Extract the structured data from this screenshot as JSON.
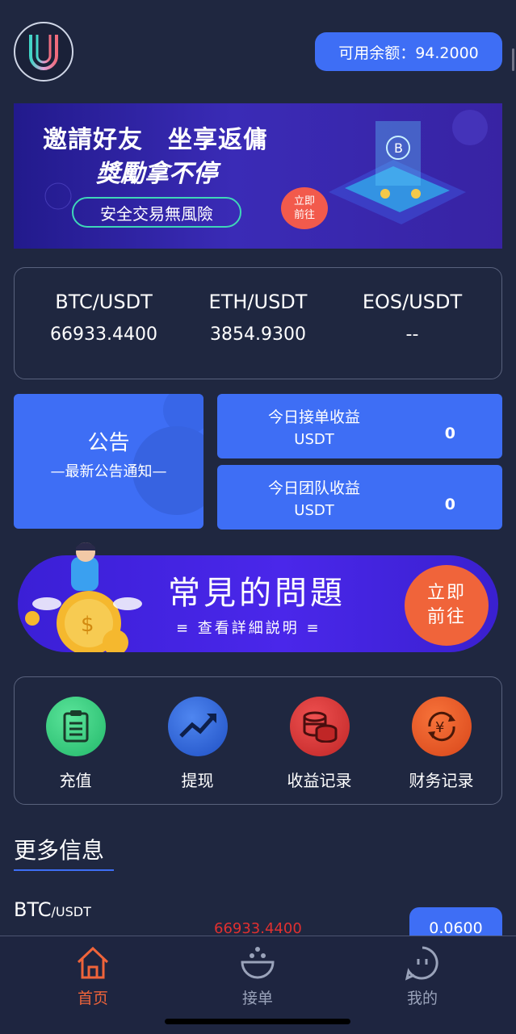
{
  "header": {
    "balance_label": "可用余额：94.2000"
  },
  "banner": {
    "line1": "邀請好友　坐享返傭",
    "line2": "獎勵拿不停",
    "pill": "安全交易無風險",
    "go_line1": "立即",
    "go_line2": "前往"
  },
  "ticker": [
    {
      "pair": "BTC/USDT",
      "price": "66933.4400"
    },
    {
      "pair": "ETH/USDT",
      "price": "3854.9300"
    },
    {
      "pair": "EOS/USDT",
      "price": "--"
    }
  ],
  "notice": {
    "title": "公告",
    "subtitle": "—最新公告通知—"
  },
  "stats": [
    {
      "label": "今日接单收益",
      "unit": "USDT",
      "value": "0"
    },
    {
      "label": "今日团队收益",
      "unit": "USDT",
      "value": "0"
    }
  ],
  "faq": {
    "title": "常見的問題",
    "subtitle": "≡ 查看詳細説明 ≡",
    "go_line1": "立即",
    "go_line2": "前往"
  },
  "quick_actions": [
    {
      "label": "充值",
      "icon": "clipboard-icon",
      "color": "#2ecc7a"
    },
    {
      "label": "提现",
      "icon": "trend-up-icon",
      "color": "#2a62d8"
    },
    {
      "label": "收益记录",
      "icon": "coins-icon",
      "color": "#d63434"
    },
    {
      "label": "财务记录",
      "icon": "yen-cycle-icon",
      "color": "#ee5a24"
    }
  ],
  "more": {
    "title": "更多信息",
    "row": {
      "pair": "BTC",
      "quote": "/USDT",
      "price": "66933.4400",
      "change": "0.0600"
    }
  },
  "tabs": [
    {
      "label": "首页",
      "icon": "home-icon",
      "active": true
    },
    {
      "label": "接单",
      "icon": "bowl-icon",
      "active": false
    },
    {
      "label": "我的",
      "icon": "chat-face-icon",
      "active": false
    }
  ],
  "colors": {
    "accent": "#3e6ef5",
    "background": "#1f2740",
    "active_tab": "#f0643a",
    "price_red": "#e03030"
  }
}
